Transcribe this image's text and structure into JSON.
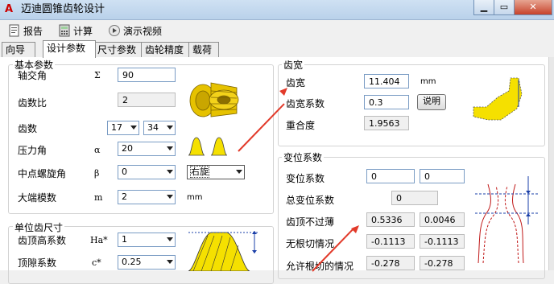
{
  "window": {
    "title": "迈迪圆锥齿轮设计",
    "logo": "A"
  },
  "toolbar": {
    "report": "报告",
    "calc": "计算",
    "demo": "演示视频"
  },
  "tabs": [
    "向导",
    "设计参数",
    "尺寸参数",
    "齿轮精度",
    "载荷"
  ],
  "basic": {
    "group_title": "基本参数",
    "shaft_angle": {
      "label": "轴交角",
      "symbol": "Σ",
      "value": "90"
    },
    "ratio": {
      "label": "齿数比",
      "value": "2"
    },
    "teeth": {
      "label": "齿数",
      "z1": "17",
      "z2": "34"
    },
    "pressure": {
      "label": "压力角",
      "symbol": "α",
      "value": "20"
    },
    "spiral": {
      "label": "中点螺旋角",
      "symbol": "β",
      "value": "0",
      "hand": "右旋"
    },
    "module": {
      "label": "大端模数",
      "symbol": "m",
      "value": "2",
      "unit": "mm"
    }
  },
  "unit_tooth": {
    "group_title": "单位齿尺寸",
    "addendum": {
      "label": "齿顶高系数",
      "symbol": "Ha*",
      "value": "1"
    },
    "clearance": {
      "label": "顶隙系数",
      "symbol": "c*",
      "value": "0.25"
    }
  },
  "facewidth": {
    "group_title": "齿宽",
    "width": {
      "label": "齿宽",
      "value": "11.404",
      "unit": "mm"
    },
    "coef": {
      "label": "齿宽系数",
      "value": "0.3",
      "button": "说明"
    },
    "overlap": {
      "label": "重合度",
      "value": "1.9563"
    }
  },
  "shift": {
    "group_title": "变位系数",
    "coef": {
      "label": "变位系数",
      "v1": "0",
      "v2": "0"
    },
    "total": {
      "label": "总变位系数",
      "value": "0"
    },
    "tip": {
      "label": "齿顶不过薄",
      "v1": "0.5336",
      "v2": "0.0046"
    },
    "undercut": {
      "label": "无根切情况",
      "v1": "-0.1113",
      "v2": "-0.1113"
    },
    "allowed": {
      "label": "允许根切的情况",
      "v1": "-0.278",
      "v2": "-0.278"
    }
  },
  "colors": {
    "accent_red": "#e23a2a",
    "gear_gold": "#e6c200"
  }
}
